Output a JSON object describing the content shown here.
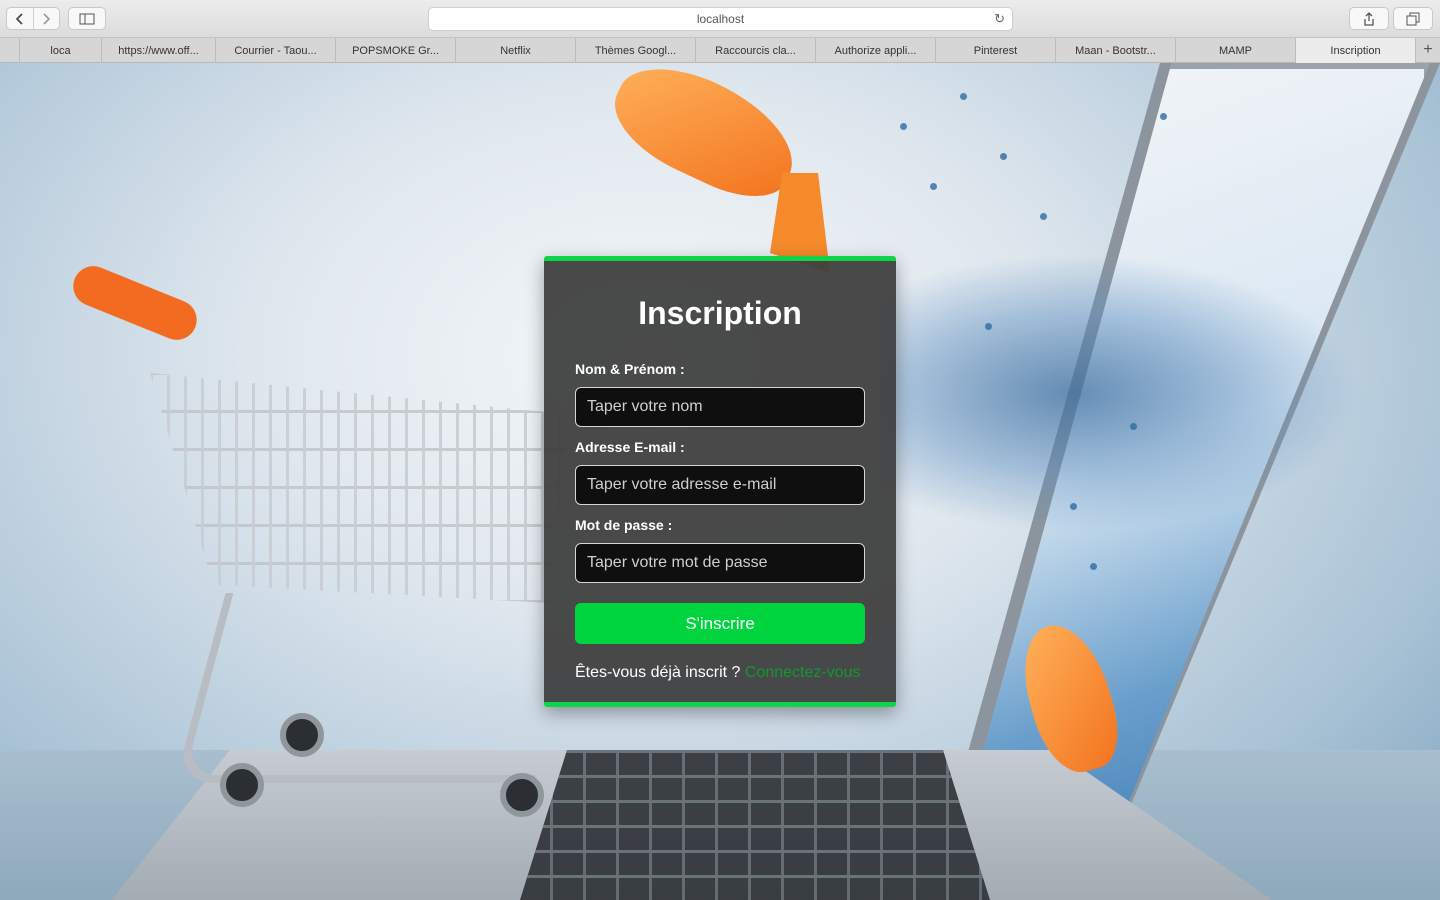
{
  "browser": {
    "address": "localhost",
    "tabs": [
      "loca",
      "https://www.off...",
      "Courrier - Taou...",
      "POPSMOKE Gr...",
      "Netflix",
      "Thèmes Googl...",
      "Raccourcis cla...",
      "Authorize appli...",
      "Pinterest",
      "Maan - Bootstr...",
      "MAMP",
      "Inscription"
    ],
    "active_tab": "Inscription"
  },
  "form": {
    "title": "Inscription",
    "name_label": "Nom & Prénom :",
    "name_placeholder": "Taper votre nom",
    "email_label": "Adresse E-mail :",
    "email_placeholder": "Taper votre adresse e-mail",
    "password_label": "Mot de passe :",
    "password_placeholder": "Taper votre mot de passe",
    "submit_label": "S'inscrire",
    "already_text": "Êtes-vous déjà inscrit ? ",
    "login_link": "Connectez-vous"
  },
  "colors": {
    "accent": "#00d43f",
    "card_bg": "#3c3c3c",
    "link": "#0f9a2f"
  }
}
